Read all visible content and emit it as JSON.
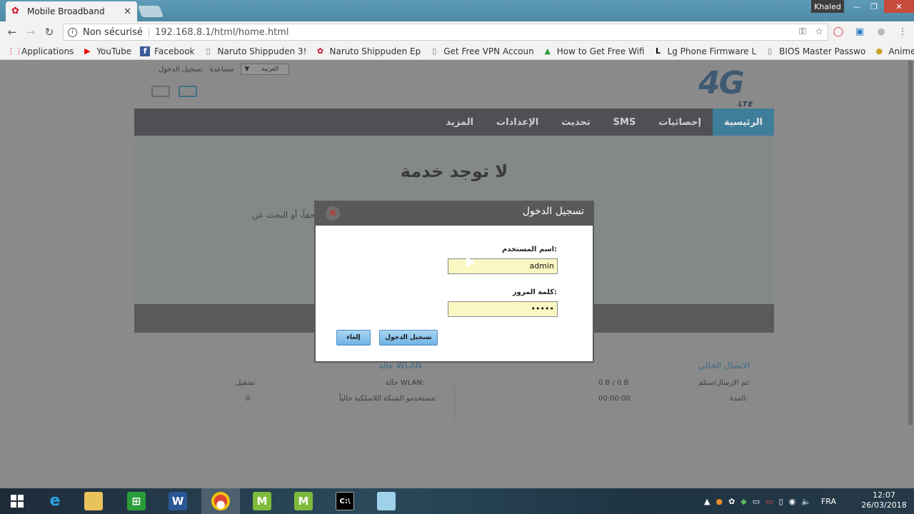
{
  "browser": {
    "tab_title": "Mobile Broadband",
    "profile_name": "Khaled",
    "security_label": "Non sécurisé",
    "url": "192.168.8.1/html/home.html",
    "bookmarks": [
      {
        "label": "Applications",
        "icon": "apps-grid-icon"
      },
      {
        "label": "YouTube",
        "icon": "youtube-icon"
      },
      {
        "label": "Facebook",
        "icon": "facebook-icon"
      },
      {
        "label": "Naruto Shippuden 3!",
        "icon": "page-icon"
      },
      {
        "label": "Naruto Shippuden Ep",
        "icon": "huawei-icon"
      },
      {
        "label": "Get Free VPN Accoun",
        "icon": "page-icon"
      },
      {
        "label": "How to Get Free Wifi",
        "icon": "cloud-icon"
      },
      {
        "label": "Lg Phone Firmware L",
        "icon": "lg-icon"
      },
      {
        "label": "BIOS Master Passwo",
        "icon": "page-icon"
      },
      {
        "label": "Anime - Naruto Shipp",
        "icon": "anime-icon"
      }
    ]
  },
  "page": {
    "top_links": {
      "language": "العربية",
      "help": "مساعدة",
      "login": "تسجيل الدخول"
    },
    "logo_text": "4G",
    "logo_sub": "LTE",
    "nav": [
      "الرئيسية",
      "إحصائيات",
      "SMS",
      "تحديث",
      "الإعدادات",
      "المزيد"
    ],
    "status_heading": "لا توجد خدمة",
    "status_text": "حقاً، أو البحث عن",
    "connection": {
      "title": "الاتصال الحالي",
      "rows": [
        {
          "label": "تم الإرسال/ستلم:",
          "value": "0 B / 0 B"
        },
        {
          "label": "المدة:",
          "value": "00:00:00"
        }
      ]
    },
    "wlan": {
      "title": "حالة WLAN",
      "rows": [
        {
          "label": "حالة WLAN:",
          "value": "تشغيل"
        },
        {
          "label": "مستخدمو الشبكة اللاسلكية حالياً:",
          "value": "0"
        }
      ]
    }
  },
  "login_dialog": {
    "title": "تسجيل الدخول",
    "username_label": "اسم المستخدم:",
    "username_value": "admin",
    "password_label": "كلمة المرور:",
    "password_value": "•••••",
    "login_button": "تسجيل الدخول",
    "cancel_button": "إلغاء"
  },
  "taskbar": {
    "language": "FRA",
    "time": "12:07",
    "date": "26/03/2018"
  }
}
